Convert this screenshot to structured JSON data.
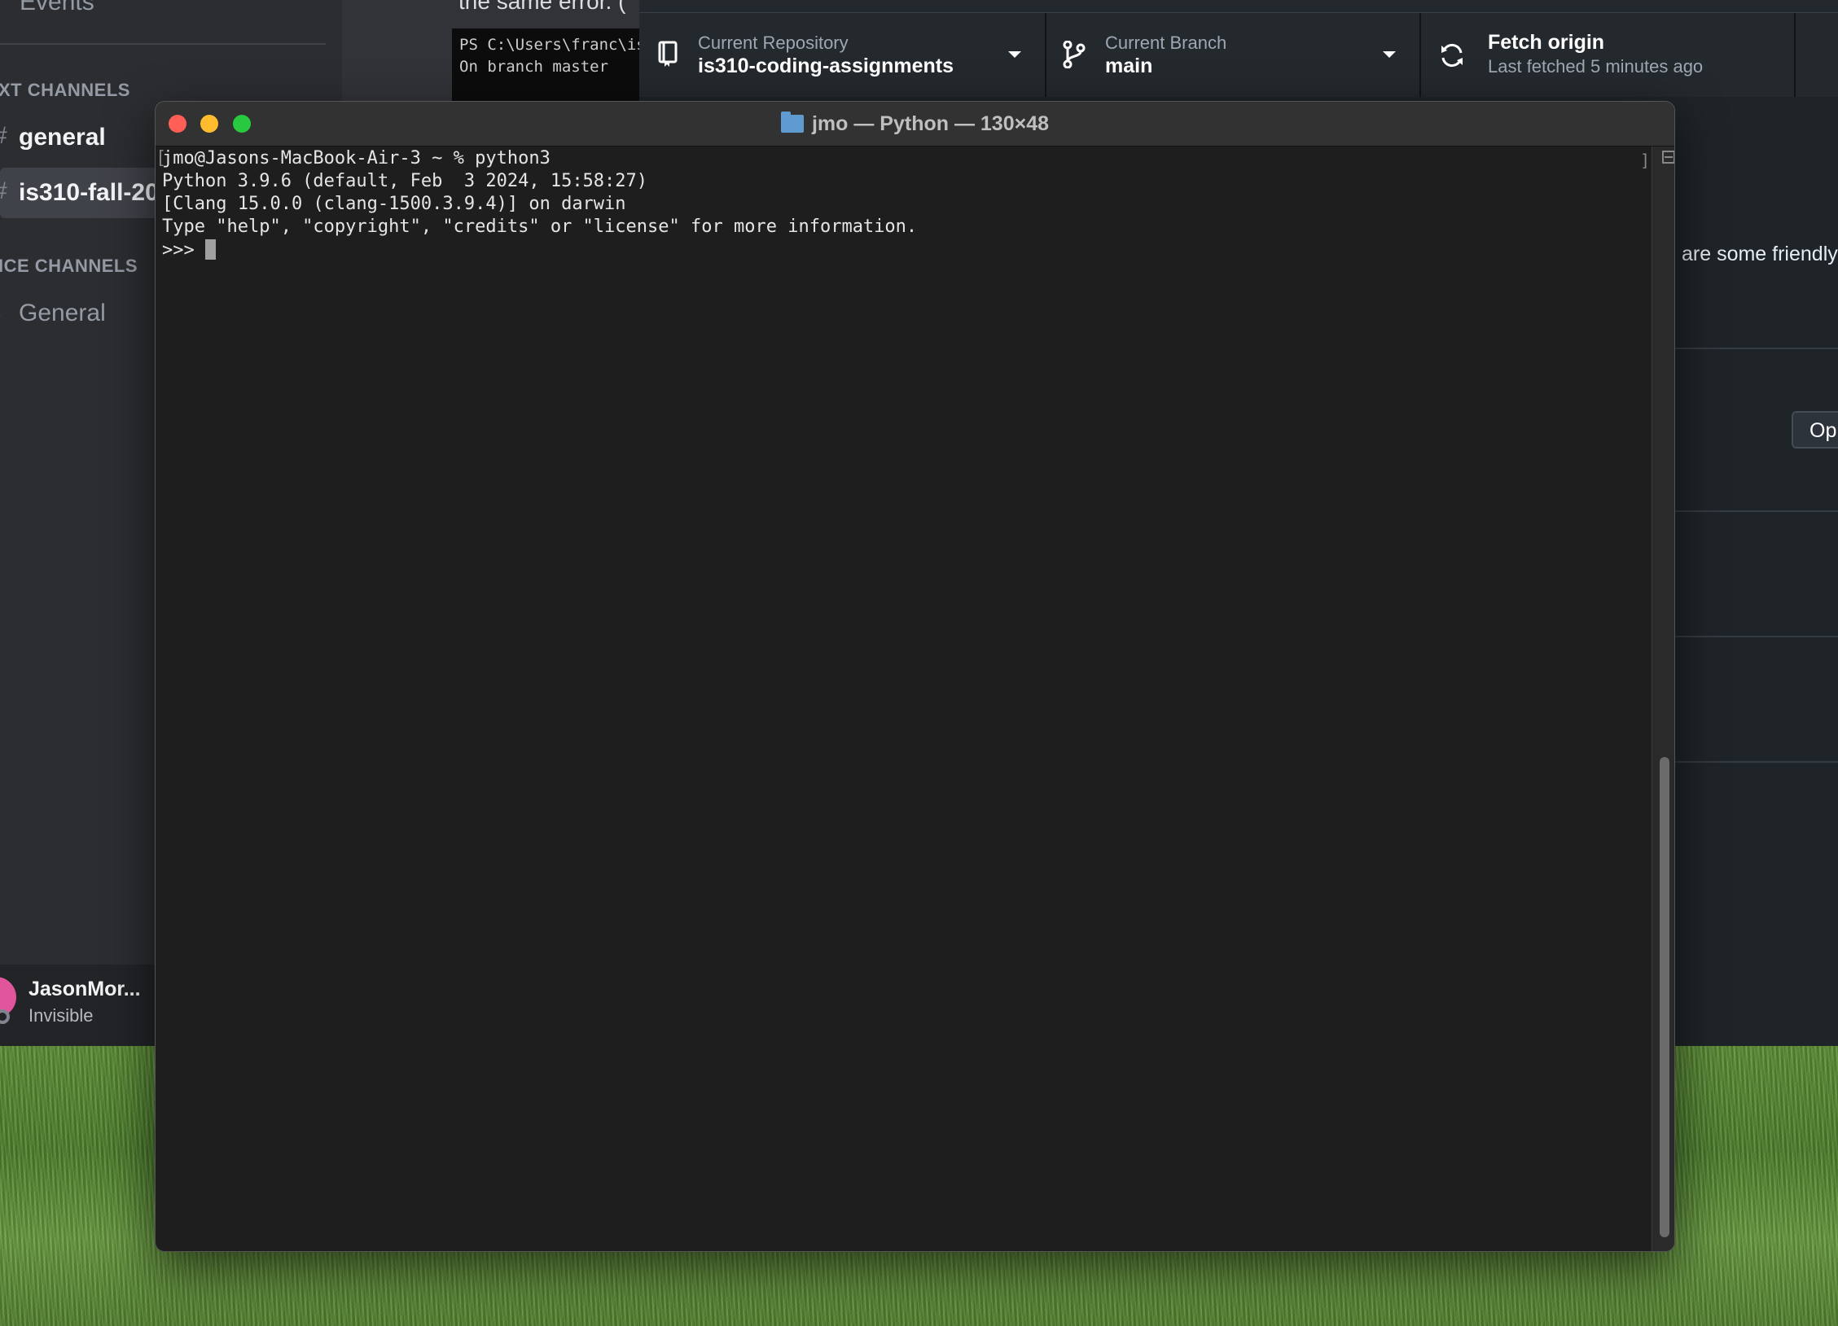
{
  "discord": {
    "events_label": "Events",
    "text_channels_label": "XT CHANNELS",
    "channels": [
      {
        "name": "general"
      },
      {
        "name": "is310-fall-20"
      }
    ],
    "voice_channels_label": "ICE CHANNELS",
    "voice_channels": [
      {
        "name": "General"
      }
    ],
    "user": {
      "name": "JasonMor...",
      "status": "Invisible"
    },
    "message_text": "the same error. (",
    "powershell": [
      "PS C:\\Users\\franc\\is",
      "On branch master"
    ]
  },
  "github": {
    "repository_label": "Current Repository",
    "repository_value": "is310-coding-assignments",
    "branch_label": "Current Branch",
    "branch_value": "main",
    "fetch_title": "Fetch origin",
    "fetch_subtitle": "Last fetched 5 minutes ago",
    "side_text": "are some friendly",
    "open_button": "Op"
  },
  "terminal": {
    "title": "jmo — Python — 130×48",
    "lines": [
      "jmo@Jasons-MacBook-Air-3 ~ % python3",
      "Python 3.9.6 (default, Feb  3 2024, 15:58:27)",
      "[Clang 15.0.0 (clang-1500.3.9.4)] on darwin",
      "Type \"help\", \"copyright\", \"credits\" or \"license\" for more information."
    ],
    "prompt": ">>> ",
    "bracket_left": "[",
    "bracket_right": "]"
  },
  "colors": {
    "close": "#ff5f57",
    "minimize": "#febc2e",
    "zoom": "#28c840"
  }
}
